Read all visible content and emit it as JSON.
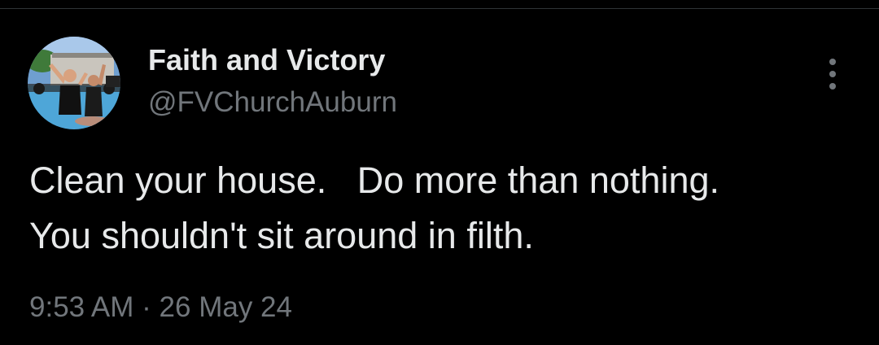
{
  "tweet": {
    "author": {
      "display_name": "Faith and Victory",
      "handle": "@FVChurchAuburn",
      "avatar_icon": "profile-photo"
    },
    "more_icon": "more-options-icon",
    "text_lines": [
      "Clean your house.   Do more than nothing.",
      "You shouldn't sit around in filth."
    ],
    "time": "9:53 AM",
    "separator": "·",
    "date": "26 May 24"
  },
  "colors": {
    "background": "#000000",
    "primary_text": "#e7e9ea",
    "secondary_text": "#71767b",
    "divider": "#2f3336"
  }
}
